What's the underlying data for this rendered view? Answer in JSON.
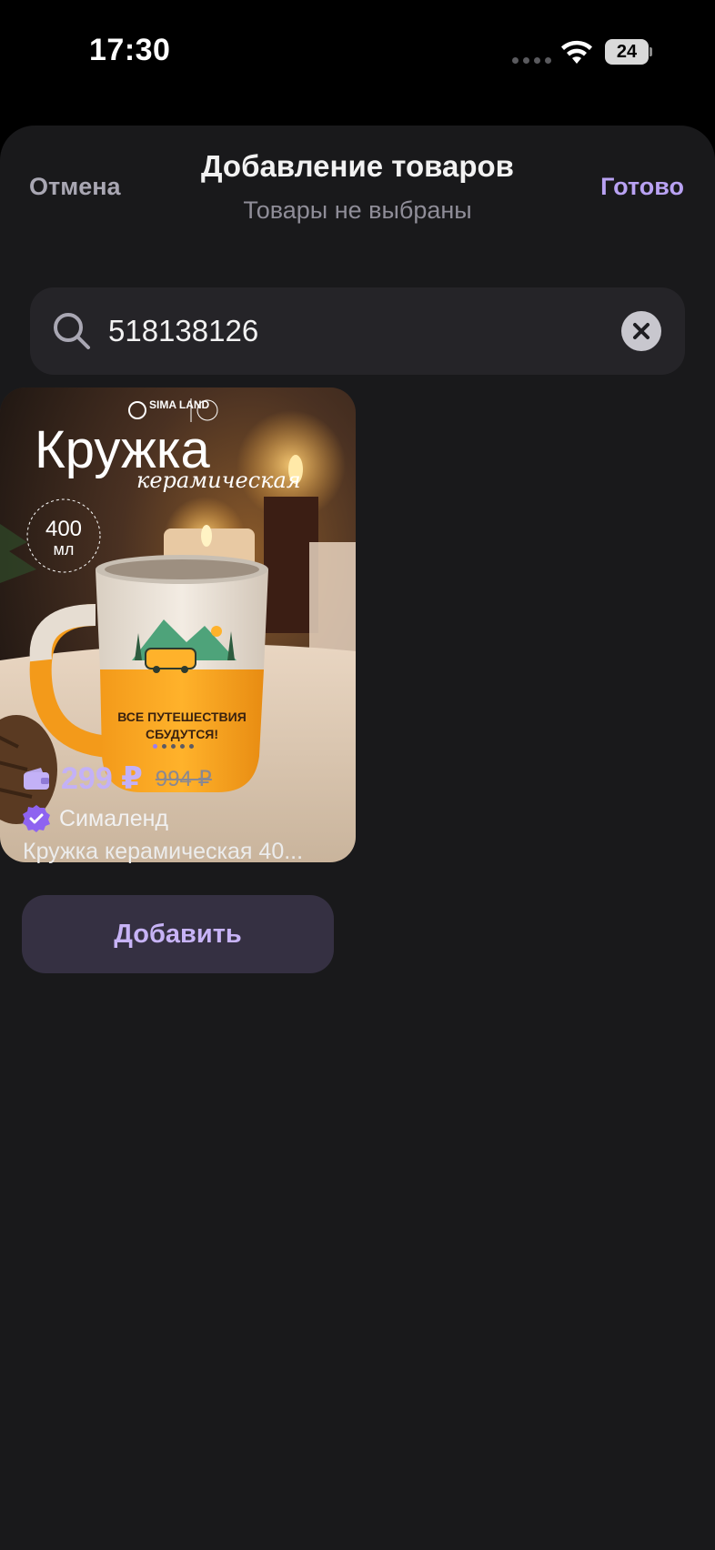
{
  "status_bar": {
    "time": "17:30",
    "battery": "24"
  },
  "sheet": {
    "cancel_label": "Отмена",
    "title": "Добавление товаров",
    "subtitle": "Товары не выбраны",
    "done_label": "Готово"
  },
  "search": {
    "value": "518138126",
    "icon": "search-icon",
    "clear_icon": "close-icon"
  },
  "product": {
    "image": {
      "brand": "SIMA LAND",
      "headline": "Кружка",
      "headline_sub": "керамическая",
      "volume_value": "400",
      "volume_unit": "мл",
      "mug_text_line1": "ВСЕ ПУТЕШЕСТВИЯ",
      "mug_text_line2": "СБУДУТСЯ!"
    },
    "pager": {
      "count": 5,
      "active": 0
    },
    "price": "299 ₽",
    "old_price": "994 ₽",
    "seller": "Сималенд",
    "title": "Кружка керамическая 40...",
    "add_label": "Добавить"
  },
  "colors": {
    "accent": "#b9a2f3",
    "sheet_bg": "#19191b",
    "button_bg": "#353042"
  }
}
